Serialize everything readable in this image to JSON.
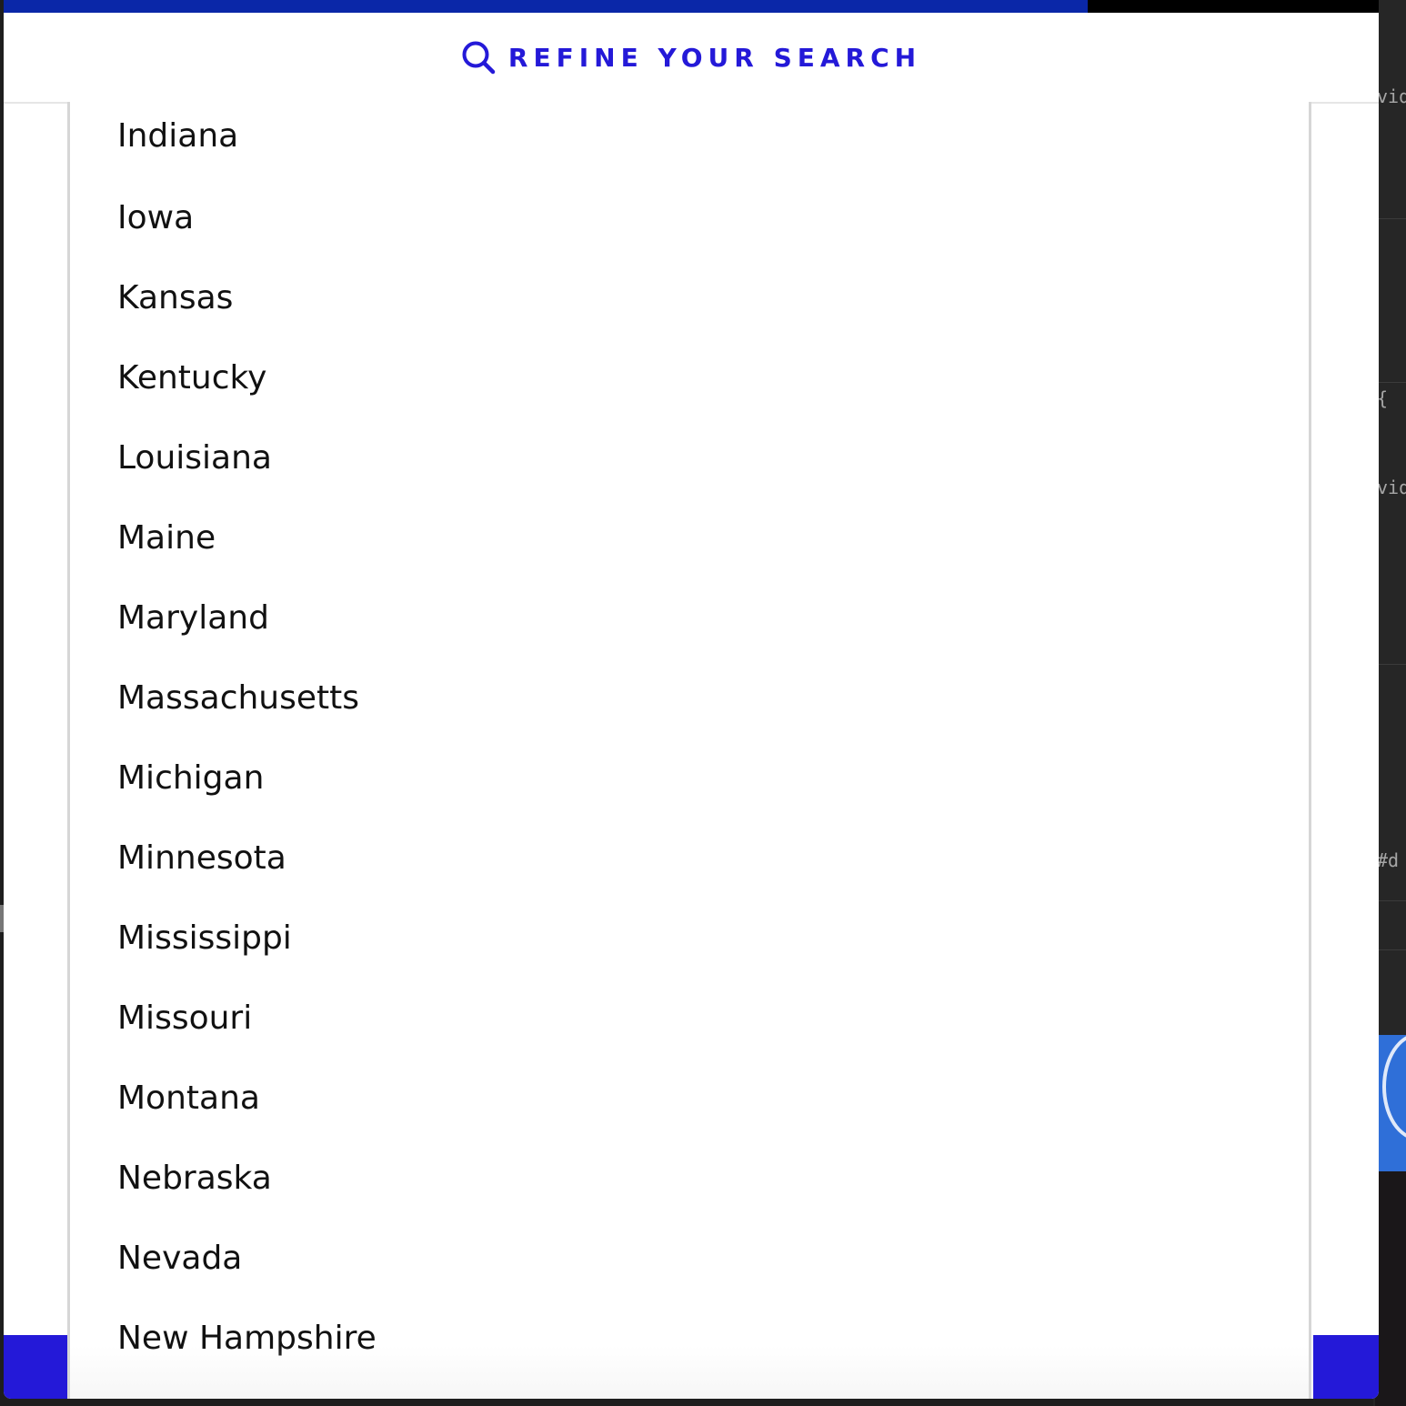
{
  "colors": {
    "accent": "#2419d8",
    "top_bar": "#0a27a8"
  },
  "background_editor": {
    "fragments": [
      "vid",
      "{",
      "vid",
      "#d"
    ]
  },
  "header": {
    "icon": "search-icon",
    "title": "REFINE YOUR SEARCH"
  },
  "states_list": {
    "items": [
      "Indiana",
      "Iowa",
      "Kansas",
      "Kentucky",
      "Louisiana",
      "Maine",
      "Maryland",
      "Massachusetts",
      "Michigan",
      "Minnesota",
      "Mississippi",
      "Missouri",
      "Montana",
      "Nebraska",
      "Nevada",
      "New Hampshire"
    ]
  }
}
